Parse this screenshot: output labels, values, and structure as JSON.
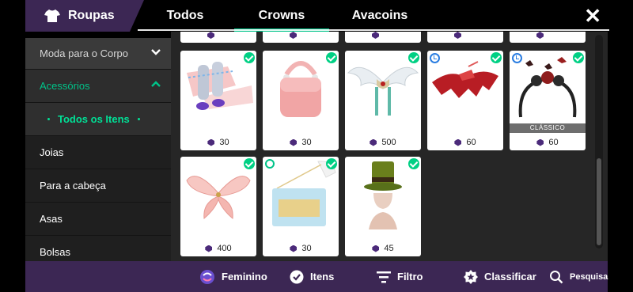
{
  "header": {
    "brand_label": "Roupas",
    "tabs": [
      {
        "label": "Todos"
      },
      {
        "label": "Crowns"
      },
      {
        "label": "Avacoins"
      }
    ],
    "active_tab": "Crowns",
    "close_symbol": "✕"
  },
  "sidebar": {
    "items": [
      {
        "label": "Moda para o Corpo"
      },
      {
        "label": "Acessórios"
      },
      {
        "label": "Todos os Itens"
      },
      {
        "label": "Joias"
      },
      {
        "label": "Para a cabeça"
      },
      {
        "label": "Asas"
      },
      {
        "label": "Bolsas"
      }
    ]
  },
  "items": [
    {
      "name": "leg-warmers",
      "price": "30",
      "owned": true
    },
    {
      "name": "pink-handbag",
      "price": "30",
      "owned": true
    },
    {
      "name": "white-wings-collar",
      "price": "500",
      "owned": true
    },
    {
      "name": "red-bat-cape",
      "price": "60",
      "owned": true,
      "timed": true
    },
    {
      "name": "bat-headband",
      "price": "60",
      "owned": true,
      "timed": true,
      "badge": "CLÁSSICO"
    },
    {
      "name": "fairy-wings",
      "price": "400",
      "owned": true
    },
    {
      "name": "gold-clutch",
      "price": "30",
      "owned": true,
      "tagged": true
    },
    {
      "name": "green-top-hat",
      "price": "45",
      "owned": true
    }
  ],
  "bottom_bar": {
    "gender_label": "Feminino",
    "items_label": "Itens",
    "filter_label": "Filtro",
    "sort_label": "Classificar",
    "search_label": "Pesquisa"
  },
  "colors": {
    "accent": "#00c389",
    "brand": "#3c2754",
    "gem": "#4b2a7a"
  }
}
